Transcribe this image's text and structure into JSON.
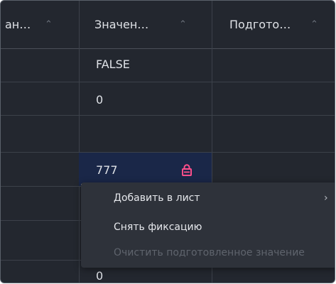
{
  "columns": [
    {
      "label": "ан…",
      "sort_icon": "sort-icon"
    },
    {
      "label": "Значен…",
      "sort_icon": "sort-icon"
    },
    {
      "label": "Подгото…",
      "sort_icon": "sort-icon"
    }
  ],
  "rows": [
    {
      "value": "FALSE"
    },
    {
      "value": "0"
    },
    {
      "value": ""
    },
    {
      "value": "777",
      "locked": true
    },
    {
      "value": ""
    },
    {
      "value": ""
    },
    {
      "value": "0"
    }
  ],
  "context_menu": {
    "items": [
      {
        "label": "Добавить в лист",
        "has_submenu": true,
        "enabled": true
      },
      {
        "label": "Снять фиксацию",
        "has_submenu": false,
        "enabled": true
      },
      {
        "label": "Очистить подготовленное значение",
        "has_submenu": false,
        "enabled": false
      }
    ]
  },
  "colors": {
    "background": "#23272f",
    "selected_cell": "#1a2748",
    "lock_icon": "#ff4f8b",
    "menu_background": "#2e323a",
    "disabled_text": "#5f646d"
  },
  "icons": {
    "lock": "lock-icon",
    "submenu": "chevron-right-icon"
  }
}
